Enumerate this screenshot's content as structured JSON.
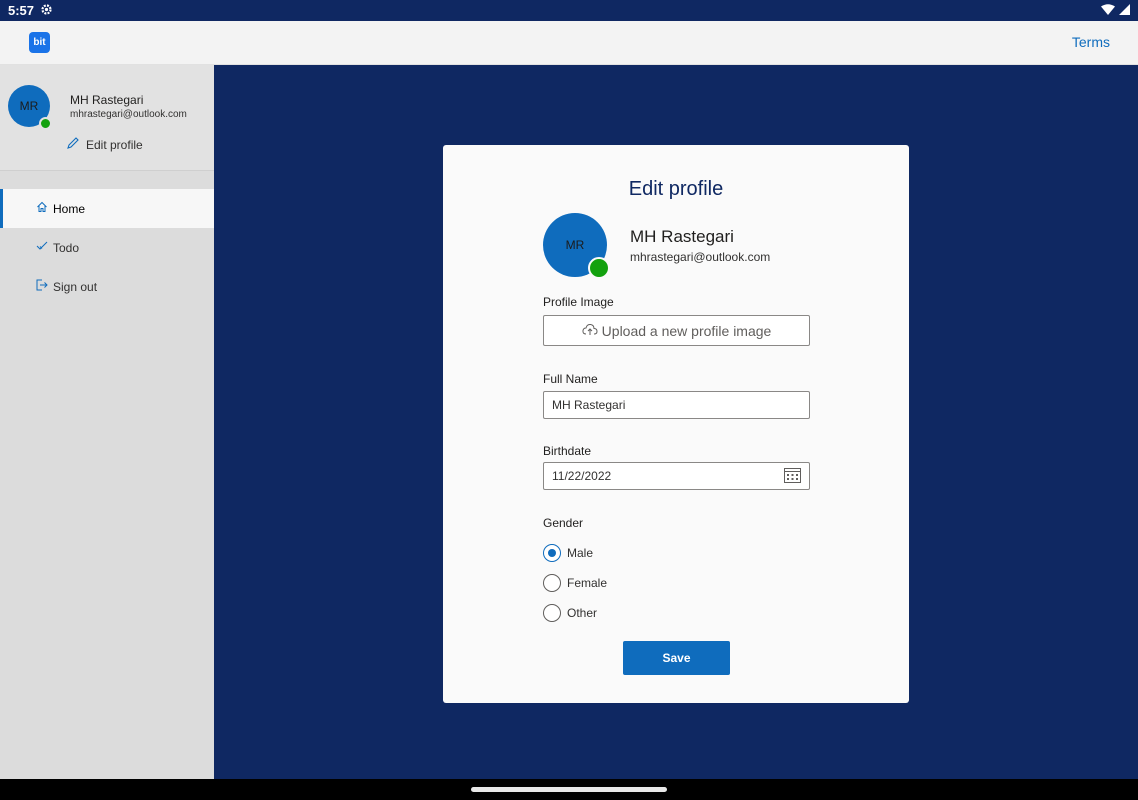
{
  "status_bar": {
    "time": "5:57"
  },
  "header": {
    "logo_text": "bit",
    "terms_label": "Terms"
  },
  "sidebar": {
    "avatar_initials": "MR",
    "user_name": "MH Rastegari",
    "user_email": "mhrastegari@outlook.com",
    "edit_profile_label": "Edit profile",
    "items": [
      {
        "label": "Home",
        "icon": "home-icon",
        "active": true
      },
      {
        "label": "Todo",
        "icon": "checkmark-icon",
        "active": false
      },
      {
        "label": "Sign out",
        "icon": "sign-out-icon",
        "active": false
      }
    ]
  },
  "form": {
    "title": "Edit profile",
    "avatar_initials": "MR",
    "user_name": "MH Rastegari",
    "user_email": "mhrastegari@outlook.com",
    "profile_image_label": "Profile Image",
    "upload_label": "Upload a new profile image",
    "full_name_label": "Full Name",
    "full_name_value": "MH Rastegari",
    "birthdate_label": "Birthdate",
    "birthdate_value": "11/22/2022",
    "gender_label": "Gender",
    "gender_options": [
      {
        "label": "Male",
        "checked": true
      },
      {
        "label": "Female",
        "checked": false
      },
      {
        "label": "Other",
        "checked": false
      }
    ],
    "save_label": "Save"
  },
  "colors": {
    "accent": "#0f6cbd",
    "background": "#0f2862",
    "presence": "#13a10e"
  }
}
